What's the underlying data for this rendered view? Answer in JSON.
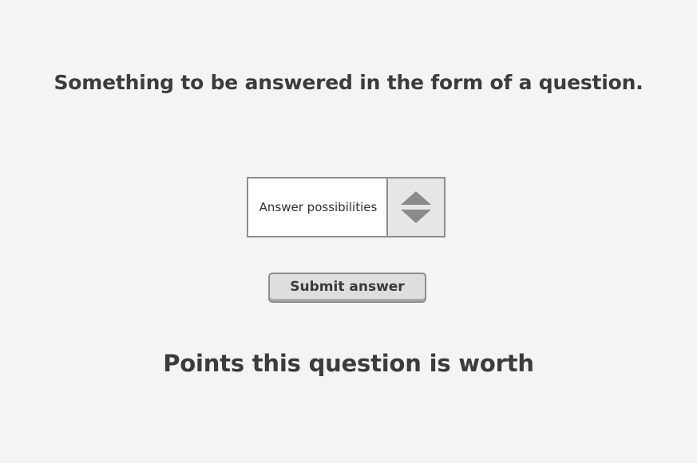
{
  "question": {
    "text": "Something to be answered in the form of a question."
  },
  "answer_select": {
    "value": "Answer possibilities",
    "stepper_icons": [
      "triangle-up-icon",
      "triangle-down-icon"
    ]
  },
  "submit": {
    "label": "Submit answer"
  },
  "points": {
    "label": "Points this question is worth"
  },
  "colors": {
    "background": "#f4f4f4",
    "text": "#3c3c3c",
    "border": "#8e8e8e",
    "stepper_bg": "#e6e6e6",
    "button_bg": "#dedede",
    "icon": "#8a8a8a"
  }
}
